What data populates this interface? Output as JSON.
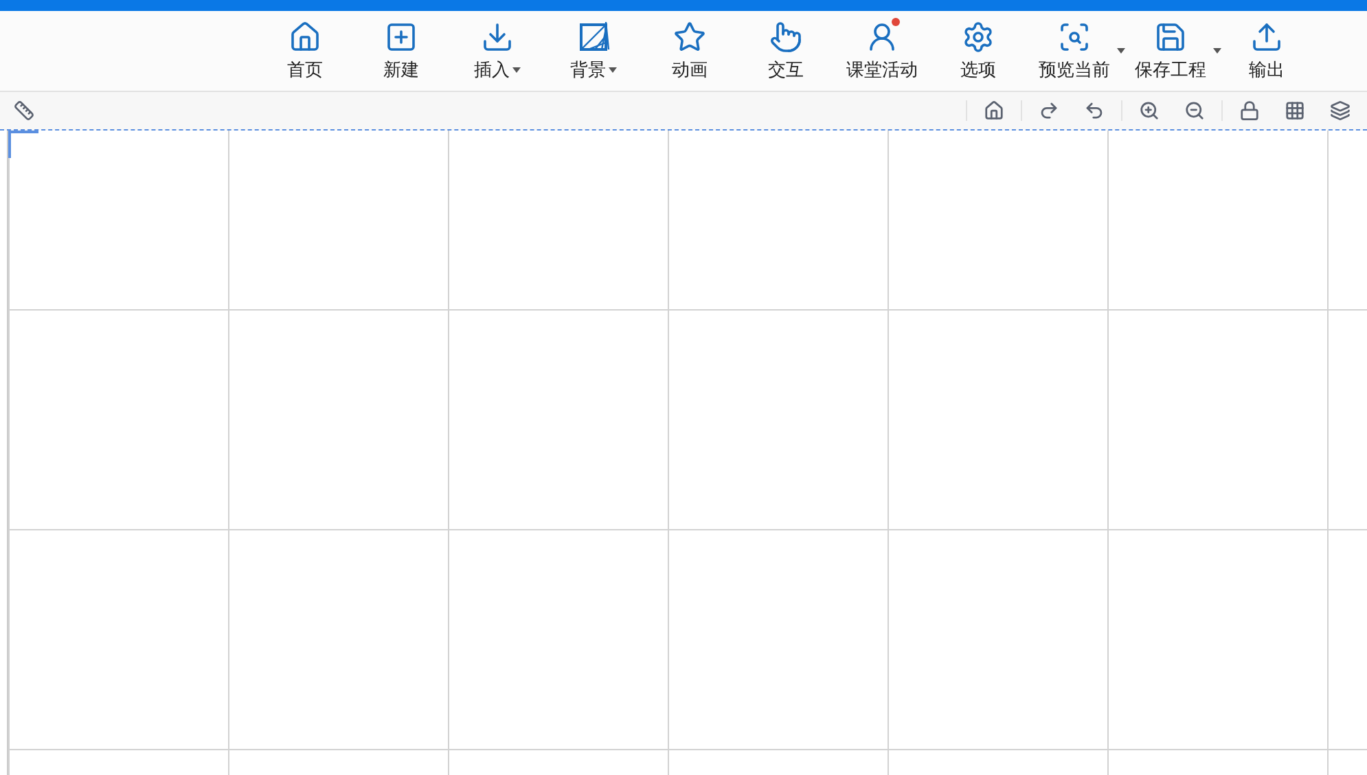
{
  "toolbar": {
    "items": [
      {
        "label": "首页",
        "kind": "plain",
        "badge": false
      },
      {
        "label": "新建",
        "kind": "plain",
        "badge": false
      },
      {
        "label": "插入",
        "kind": "menu-inline",
        "badge": false
      },
      {
        "label": "背景",
        "kind": "menu-inline",
        "badge": false
      },
      {
        "label": "动画",
        "kind": "plain",
        "badge": false
      },
      {
        "label": "交互",
        "kind": "plain",
        "badge": false
      },
      {
        "label": "课堂活动",
        "kind": "plain",
        "badge": true
      },
      {
        "label": "选项",
        "kind": "plain",
        "badge": false
      },
      {
        "label": "预览当前",
        "kind": "menu-side",
        "badge": false
      },
      {
        "label": "保存工程",
        "kind": "menu-side",
        "badge": false
      },
      {
        "label": "输出",
        "kind": "plain",
        "badge": false
      }
    ]
  }
}
